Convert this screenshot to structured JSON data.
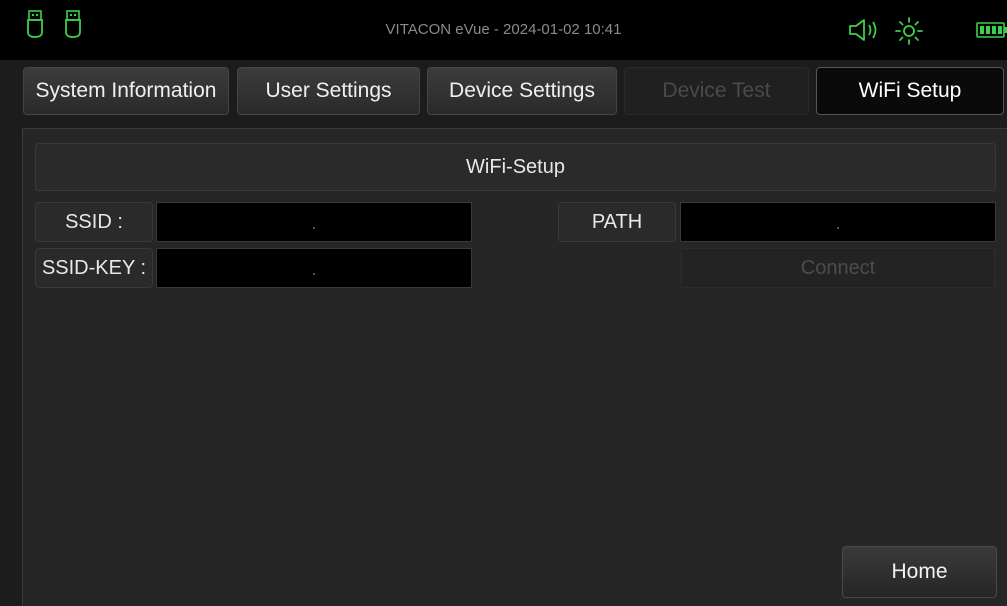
{
  "statusbar": {
    "title": "VITACON eVue - 2024-01-02 10:41",
    "icons": [
      "usb-icon",
      "usb-icon",
      "speaker-icon",
      "brightness-icon",
      "battery-icon"
    ],
    "accent_color": "#3ecf4a"
  },
  "tabs": [
    {
      "label": "System Information",
      "state": "normal"
    },
    {
      "label": "User Settings",
      "state": "normal"
    },
    {
      "label": "Device Settings",
      "state": "normal"
    },
    {
      "label": "Device Test",
      "state": "disabled"
    },
    {
      "label": "WiFi Setup",
      "state": "active"
    }
  ],
  "wifi": {
    "header": "WiFi-Setup",
    "ssid_label": "SSID :",
    "ssid_value": ".",
    "ssid_key_label": "SSID-KEY :",
    "ssid_key_value": ".",
    "path_label": "PATH",
    "path_value": ".",
    "connect_label": "Connect"
  },
  "footer": {
    "home_label": "Home"
  }
}
